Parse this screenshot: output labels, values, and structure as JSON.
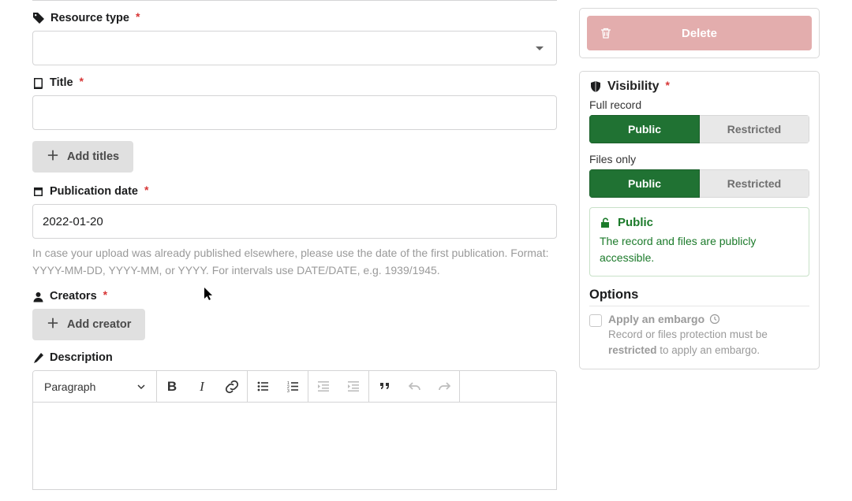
{
  "form": {
    "resource_type": {
      "label": "Resource type",
      "value": ""
    },
    "title": {
      "label": "Title",
      "value": ""
    },
    "add_titles_btn": "Add titles",
    "publication_date": {
      "label": "Publication date",
      "value": "2022-01-20",
      "help": "In case your upload was already published elsewhere, please use the date of the first publication. Format: YYYY-MM-DD, YYYY-MM, or YYYY. For intervals use DATE/DATE, e.g. 1939/1945."
    },
    "creators": {
      "label": "Creators",
      "add_btn": "Add creator"
    },
    "description": {
      "label": "Description"
    },
    "editor": {
      "heading_selector": "Paragraph"
    }
  },
  "sidebar": {
    "delete_btn": "Delete",
    "visibility": {
      "label": "Visibility",
      "full_record_label": "Full record",
      "files_only_label": "Files only",
      "public_label": "Public",
      "restricted_label": "Restricted",
      "full_record": "public",
      "files_only": "public",
      "status": {
        "title": "Public",
        "body": "The record and files are publicly accessible."
      }
    },
    "options": {
      "label": "Options",
      "embargo_label": "Apply an embargo",
      "embargo_help_prefix": "Record or files protection must be ",
      "embargo_help_bold": "restricted",
      "embargo_help_suffix": " to apply an embargo."
    }
  },
  "colors": {
    "accent_green": "#207233",
    "required_red": "#d73636",
    "delete_bg": "#e3adad"
  }
}
